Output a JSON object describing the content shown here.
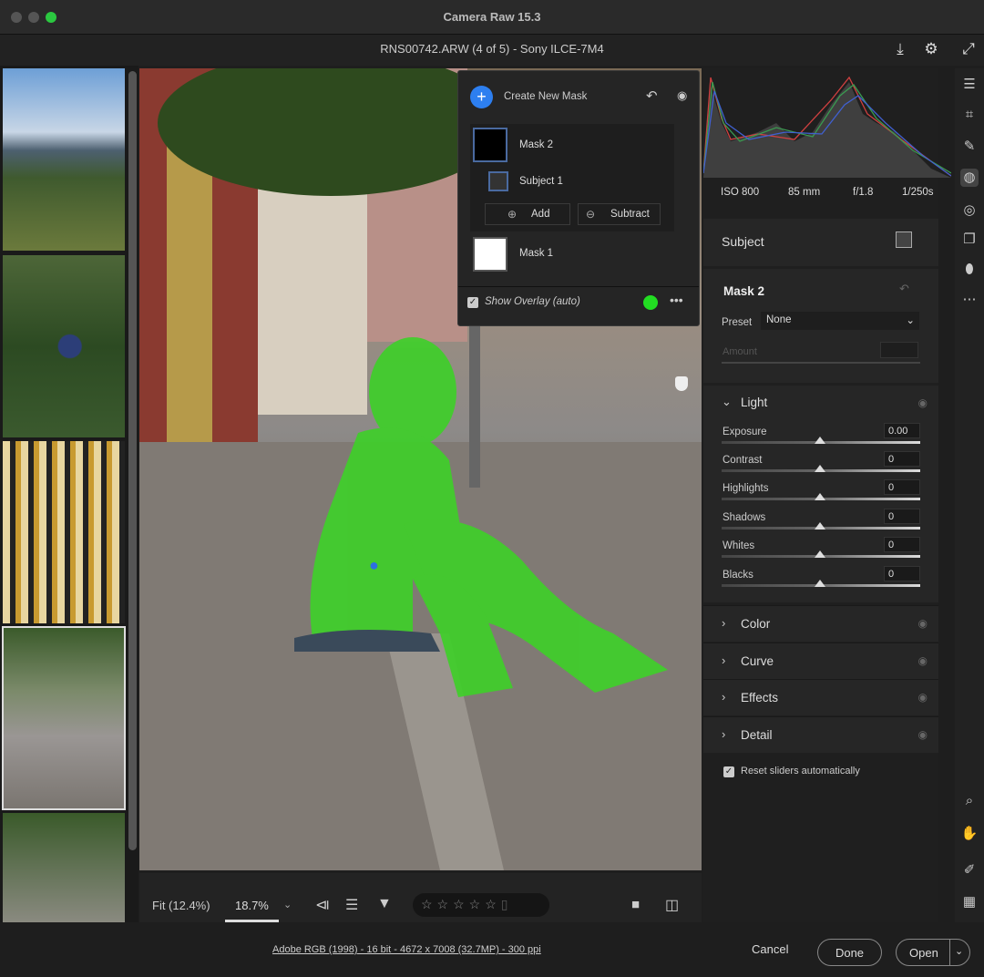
{
  "window": {
    "title": "Camera Raw 15.3",
    "file_info": "RNS00742.ARW (4 of 5)  -  Sony ILCE-7M4"
  },
  "colors": {
    "mask_overlay": "#3fcf2a",
    "accent": "#2d7ff0",
    "overlay_dot": "#22dd22"
  },
  "mask_panel": {
    "create_label": "Create New Mask",
    "masks": [
      {
        "name": "Mask 2",
        "components": [
          {
            "name": "Subject 1"
          }
        ]
      },
      {
        "name": "Mask 1"
      }
    ],
    "add_label": "Add",
    "subtract_label": "Subtract",
    "show_overlay_label": "Show Overlay (auto)",
    "show_overlay_checked": true
  },
  "exif": {
    "iso": "ISO 800",
    "focal": "85 mm",
    "aperture": "f/1.8",
    "shutter": "1/250s"
  },
  "right_panel": {
    "subject_title": "Subject",
    "mask_title": "Mask 2",
    "preset_label": "Preset",
    "preset_value": "None",
    "amount_label": "Amount",
    "light_title": "Light",
    "sliders": [
      {
        "label": "Exposure",
        "value": "0.00"
      },
      {
        "label": "Contrast",
        "value": "0"
      },
      {
        "label": "Highlights",
        "value": "0"
      },
      {
        "label": "Shadows",
        "value": "0"
      },
      {
        "label": "Whites",
        "value": "0"
      },
      {
        "label": "Blacks",
        "value": "0"
      }
    ],
    "sections": [
      "Color",
      "Curve",
      "Effects",
      "Detail"
    ],
    "reset_label": "Reset sliders automatically",
    "reset_checked": true
  },
  "toolbar": {
    "fit_label": "Fit (12.4%)",
    "zoom_value": "18.7%",
    "rating": 0
  },
  "status": {
    "info": "Adobe RGB (1998) - 16 bit - 4672 x 7008 (32.7MP) - 300 ppi",
    "cancel": "Cancel",
    "done": "Done",
    "open": "Open"
  }
}
